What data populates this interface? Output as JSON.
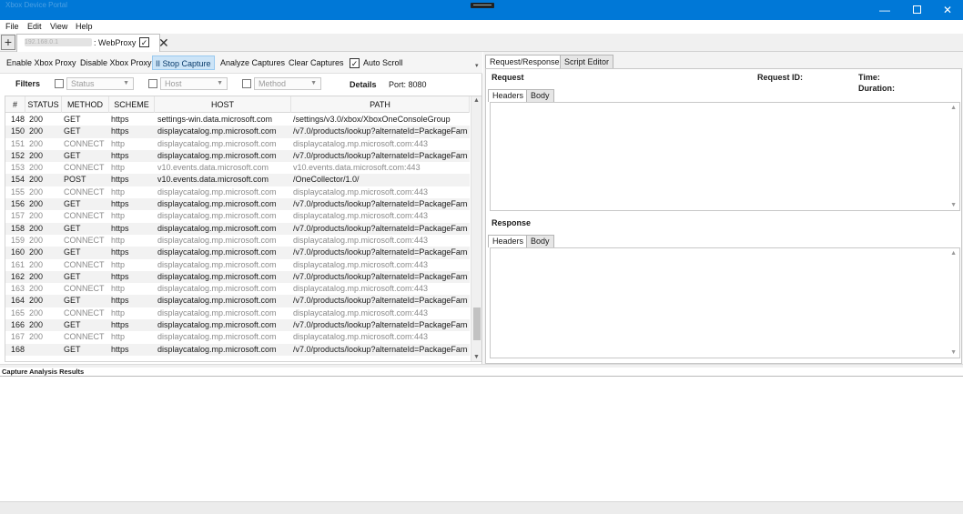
{
  "window": {
    "title_text": "Xbox Device Portal",
    "minimize_glyph": "—",
    "close_glyph": "✕"
  },
  "menu": [
    "File",
    "Edit",
    "View",
    "Help"
  ],
  "doc_tab": {
    "add_glyph": "+",
    "host_blurred": "192.168.0.1",
    "name": ": WebProxy",
    "check_glyph": "✓",
    "close_glyph": "✕"
  },
  "toolbar": {
    "enable": "Enable Xbox Proxy",
    "disable": "Disable Xbox Proxy",
    "stop": "II  Stop Capture",
    "analyze": "Analyze Captures",
    "clear": "Clear Captures",
    "autoscroll": "Auto Scroll",
    "autoscroll_checked": "✓",
    "overflow": "▾"
  },
  "filters": {
    "label": "Filters",
    "status_placeholder": "Status",
    "host_placeholder": "Host",
    "method_placeholder": "Method",
    "details_label": "Details",
    "port": "Port: 8080"
  },
  "grid": {
    "columns": [
      "#",
      "STATUS",
      "METHOD",
      "SCHEME",
      "HOST",
      "PATH"
    ],
    "rows": [
      {
        "n": "148",
        "status": "200",
        "method": "GET",
        "scheme": "https",
        "host": "settings-win.data.microsoft.com",
        "path": "/settings/v3.0/xbox/XboxOneConsoleGroup",
        "dim": false
      },
      {
        "n": "150",
        "status": "200",
        "method": "GET",
        "scheme": "https",
        "host": "displaycatalog.mp.microsoft.com",
        "path": "/v7.0/products/lookup?alternateId=PackageFami",
        "dim": false
      },
      {
        "n": "151",
        "status": "200",
        "method": "CONNECT",
        "scheme": "http",
        "host": "displaycatalog.mp.microsoft.com",
        "path": "displaycatalog.mp.microsoft.com:443",
        "dim": true
      },
      {
        "n": "152",
        "status": "200",
        "method": "GET",
        "scheme": "https",
        "host": "displaycatalog.mp.microsoft.com",
        "path": "/v7.0/products/lookup?alternateId=PackageFami",
        "dim": false
      },
      {
        "n": "153",
        "status": "200",
        "method": "CONNECT",
        "scheme": "http",
        "host": "v10.events.data.microsoft.com",
        "path": "v10.events.data.microsoft.com:443",
        "dim": true
      },
      {
        "n": "154",
        "status": "200",
        "method": "POST",
        "scheme": "https",
        "host": "v10.events.data.microsoft.com",
        "path": "/OneCollector/1.0/",
        "dim": false
      },
      {
        "n": "155",
        "status": "200",
        "method": "CONNECT",
        "scheme": "http",
        "host": "displaycatalog.mp.microsoft.com",
        "path": "displaycatalog.mp.microsoft.com:443",
        "dim": true
      },
      {
        "n": "156",
        "status": "200",
        "method": "GET",
        "scheme": "https",
        "host": "displaycatalog.mp.microsoft.com",
        "path": "/v7.0/products/lookup?alternateId=PackageFami",
        "dim": false
      },
      {
        "n": "157",
        "status": "200",
        "method": "CONNECT",
        "scheme": "http",
        "host": "displaycatalog.mp.microsoft.com",
        "path": "displaycatalog.mp.microsoft.com:443",
        "dim": true
      },
      {
        "n": "158",
        "status": "200",
        "method": "GET",
        "scheme": "https",
        "host": "displaycatalog.mp.microsoft.com",
        "path": "/v7.0/products/lookup?alternateId=PackageFami",
        "dim": false
      },
      {
        "n": "159",
        "status": "200",
        "method": "CONNECT",
        "scheme": "http",
        "host": "displaycatalog.mp.microsoft.com",
        "path": "displaycatalog.mp.microsoft.com:443",
        "dim": true
      },
      {
        "n": "160",
        "status": "200",
        "method": "GET",
        "scheme": "https",
        "host": "displaycatalog.mp.microsoft.com",
        "path": "/v7.0/products/lookup?alternateId=PackageFami",
        "dim": false
      },
      {
        "n": "161",
        "status": "200",
        "method": "CONNECT",
        "scheme": "http",
        "host": "displaycatalog.mp.microsoft.com",
        "path": "displaycatalog.mp.microsoft.com:443",
        "dim": true
      },
      {
        "n": "162",
        "status": "200",
        "method": "GET",
        "scheme": "https",
        "host": "displaycatalog.mp.microsoft.com",
        "path": "/v7.0/products/lookup?alternateId=PackageFami",
        "dim": false
      },
      {
        "n": "163",
        "status": "200",
        "method": "CONNECT",
        "scheme": "http",
        "host": "displaycatalog.mp.microsoft.com",
        "path": "displaycatalog.mp.microsoft.com:443",
        "dim": true
      },
      {
        "n": "164",
        "status": "200",
        "method": "GET",
        "scheme": "https",
        "host": "displaycatalog.mp.microsoft.com",
        "path": "/v7.0/products/lookup?alternateId=PackageFami",
        "dim": false
      },
      {
        "n": "165",
        "status": "200",
        "method": "CONNECT",
        "scheme": "http",
        "host": "displaycatalog.mp.microsoft.com",
        "path": "displaycatalog.mp.microsoft.com:443",
        "dim": true
      },
      {
        "n": "166",
        "status": "200",
        "method": "GET",
        "scheme": "https",
        "host": "displaycatalog.mp.microsoft.com",
        "path": "/v7.0/products/lookup?alternateId=PackageFami",
        "dim": false
      },
      {
        "n": "167",
        "status": "200",
        "method": "CONNECT",
        "scheme": "http",
        "host": "displaycatalog.mp.microsoft.com",
        "path": "displaycatalog.mp.microsoft.com:443",
        "dim": true
      },
      {
        "n": "168",
        "status": "",
        "method": "GET",
        "scheme": "https",
        "host": "displaycatalog.mp.microsoft.com",
        "path": "/v7.0/products/lookup?alternateId=PackageFami",
        "dim": false
      }
    ]
  },
  "right": {
    "tab_reqresp": "Request/Response",
    "tab_script": "Script Editor",
    "request_label": "Request",
    "request_id_label": "Request ID:",
    "time_label": "Time:",
    "duration_label": "Duration:",
    "headers_tab": "Headers",
    "body_tab": "Body",
    "response_label": "Response"
  },
  "analysis": {
    "label": "Capture Analysis Results"
  },
  "colors": {
    "titlebar": "#0078d7",
    "active_button": "#cce4f7"
  }
}
